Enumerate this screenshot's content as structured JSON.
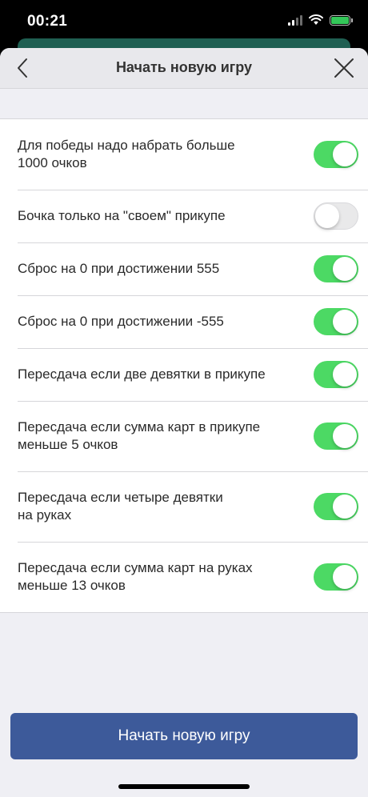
{
  "status_bar": {
    "time": "00:21",
    "battery_color": "#34c759"
  },
  "nav": {
    "title": "Начать новую игру",
    "back_icon": "chevron-left-icon",
    "close_icon": "close-icon"
  },
  "settings": [
    {
      "label": "Для победы надо набрать больше\n1000 очков",
      "enabled": true
    },
    {
      "label": "Бочка только на \"своем\" прикупе",
      "enabled": false
    },
    {
      "label": "Сброс на 0 при достижении 555",
      "enabled": true
    },
    {
      "label": "Сброс на 0 при достижении -555",
      "enabled": true
    },
    {
      "label": "Пересдача если две девятки в прикупе",
      "enabled": true
    },
    {
      "label": "Пересдача если сумма карт в прикупе\nменьше 5 очков",
      "enabled": true
    },
    {
      "label": "Пересдача если четыре девятки\nна руках",
      "enabled": true
    },
    {
      "label": "Пересдача если сумма карт на руках\nменьше 13 очков",
      "enabled": true
    }
  ],
  "start_button": {
    "label": "Начать новую игру"
  },
  "colors": {
    "toggle_on": "#4cd964",
    "toggle_off": "#e9e9ea",
    "button": "#3d5a9a"
  }
}
